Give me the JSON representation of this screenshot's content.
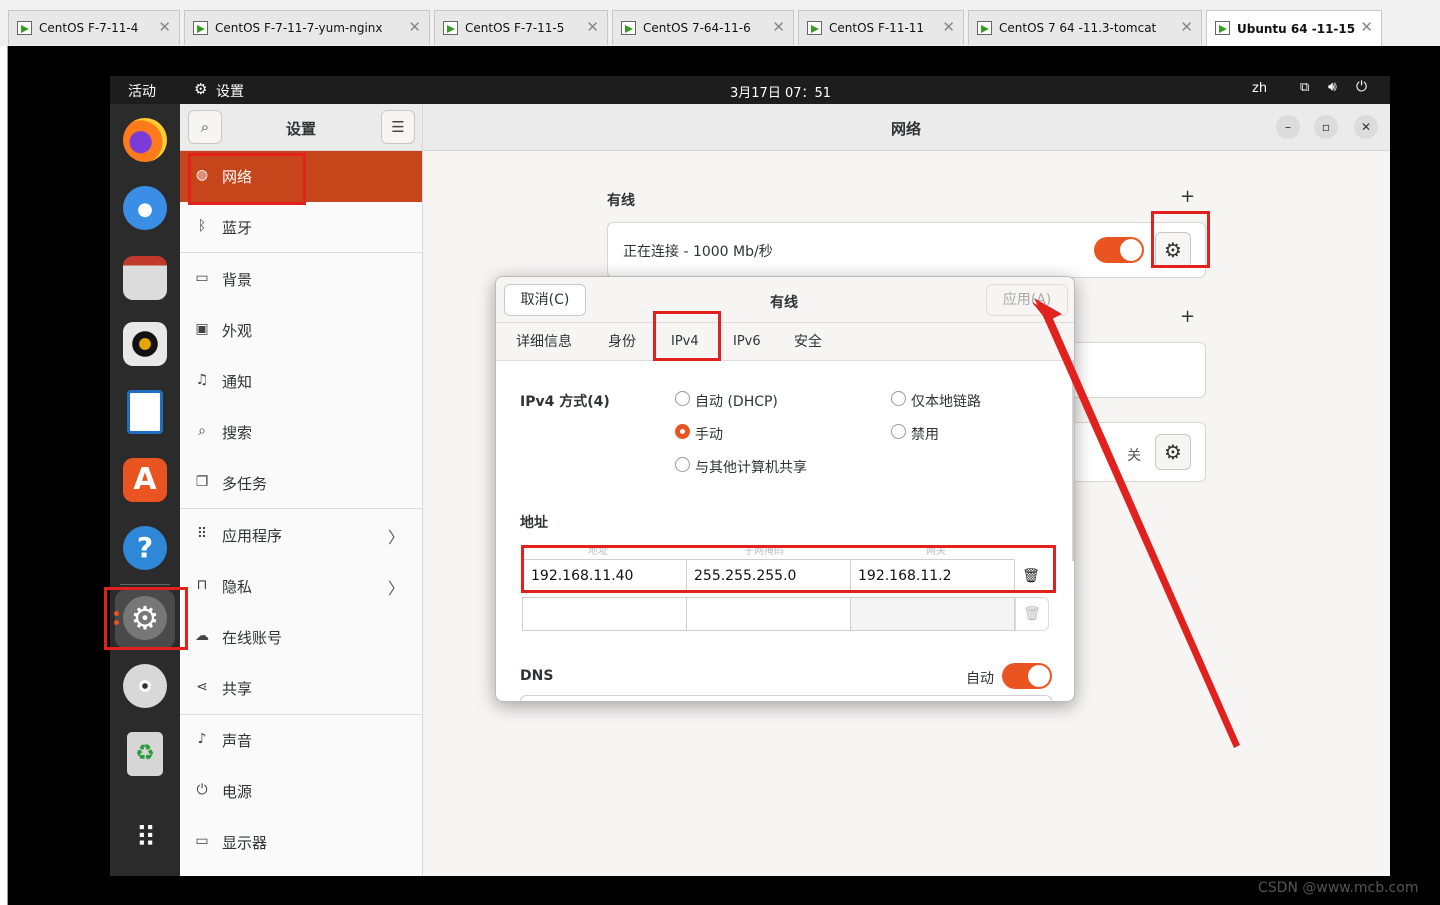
{
  "vm_tabs": [
    {
      "label": "CentOS F-7-11-4"
    },
    {
      "label": "CentOS F-7-11-7-yum-nginx"
    },
    {
      "label": "CentOS F-7-11-5"
    },
    {
      "label": "CentOS 7-64-11-6"
    },
    {
      "label": "CentOS F-11-11"
    },
    {
      "label": "CentOS 7 64 -11.3-tomcat"
    },
    {
      "label": "Ubuntu 64 -11-15"
    }
  ],
  "topbar": {
    "activities": "活动",
    "app": "设置",
    "datetime": "3月17日 07：51",
    "lang": "zh",
    "network_icon": "network-icon",
    "volume_icon": "volume-icon",
    "power_icon": "power-icon"
  },
  "dock": [
    {
      "name": "firefox"
    },
    {
      "name": "thunderbird"
    },
    {
      "name": "files"
    },
    {
      "name": "rhythmbox"
    },
    {
      "name": "libreoffice-writer"
    },
    {
      "name": "app-center"
    },
    {
      "name": "help"
    },
    {
      "name": "settings"
    },
    {
      "name": "dvd"
    },
    {
      "name": "trash"
    },
    {
      "name": "app-grid"
    }
  ],
  "sidebar": {
    "title": "设置",
    "items": [
      {
        "label": "网络",
        "icon": "globe-icon",
        "selected": true
      },
      {
        "label": "蓝牙",
        "icon": "bluetooth-icon"
      },
      {
        "label": "背景",
        "icon": "monitor-icon"
      },
      {
        "label": "外观",
        "icon": "appearance-icon"
      },
      {
        "label": "通知",
        "icon": "bell-icon"
      },
      {
        "label": "搜索",
        "icon": "search-icon"
      },
      {
        "label": "多任务",
        "icon": "multitask-icon"
      },
      {
        "label": "应用程序",
        "icon": "apps-icon",
        "arrow": "〉"
      },
      {
        "label": "隐私",
        "icon": "lock-icon",
        "arrow": "〉"
      },
      {
        "label": "在线账号",
        "icon": "cloud-icon"
      },
      {
        "label": "共享",
        "icon": "share-icon"
      },
      {
        "label": "声音",
        "icon": "music-icon"
      },
      {
        "label": "电源",
        "icon": "power-icon"
      },
      {
        "label": "显示器",
        "icon": "display-icon"
      }
    ]
  },
  "main": {
    "title": "网络",
    "wired_heading": "有线",
    "wired_status": "正在连接 - 1000 Mb/秒",
    "add": "+",
    "vpn_off": "关"
  },
  "dialog": {
    "cancel": "取消(C)",
    "title": "有线",
    "apply": "应用(A)",
    "tabs": [
      "详细信息",
      "身份",
      "IPv4",
      "IPv6",
      "安全"
    ],
    "method_label": "IPv4 方式(4)",
    "methods": [
      {
        "label": "自动 (DHCP)",
        "selected": false
      },
      {
        "label": "手动",
        "selected": true
      },
      {
        "label": "与其他计算机共享",
        "selected": false
      },
      {
        "label": "仅本地链路",
        "selected": false
      },
      {
        "label": "禁用",
        "selected": false
      }
    ],
    "address_heading": "地址",
    "columns": [
      "地址",
      "子网掩码",
      "网关"
    ],
    "rows": [
      [
        "192.168.11.40",
        "255.255.255.0",
        "192.168.11.2"
      ],
      [
        "",
        "",
        ""
      ]
    ],
    "dns_label": "DNS",
    "dns_auto": "自动"
  },
  "watermark": "CSDN @www.mcb.com",
  "colors": {
    "accent": "#e95420",
    "selected": "#c7451a",
    "annotation": "#e0211d"
  }
}
